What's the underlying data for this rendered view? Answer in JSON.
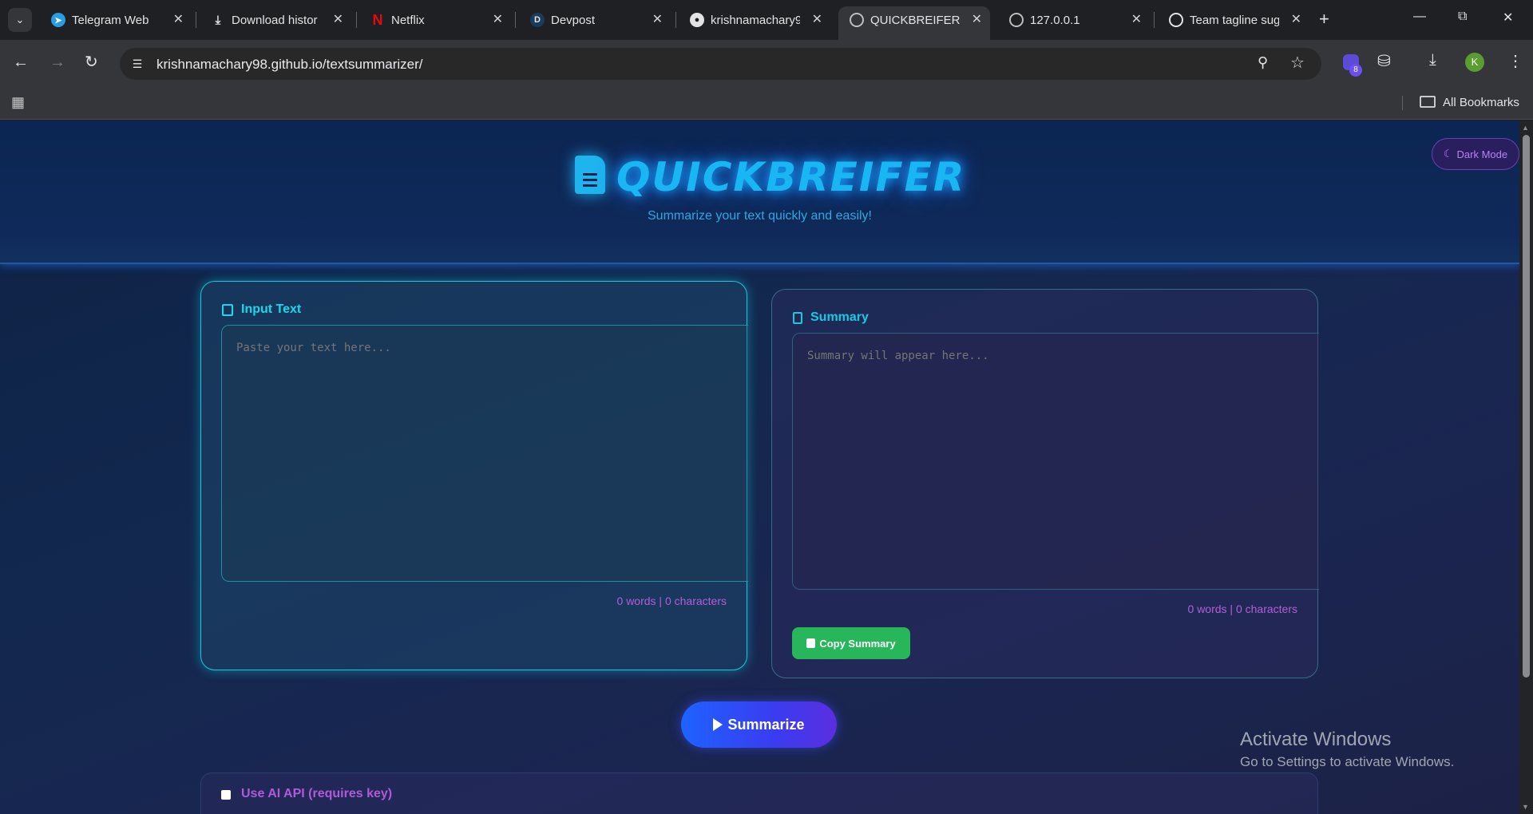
{
  "browser": {
    "tabs": [
      {
        "title": "Telegram Web",
        "icon": "telegram-icon",
        "color": "#2a9de0"
      },
      {
        "title": "Download histor",
        "icon": "download-icon",
        "color": "#e3e3e3"
      },
      {
        "title": "Netflix",
        "icon": "netflix-icon",
        "color": "#e50914"
      },
      {
        "title": "Devpost",
        "icon": "devpost-icon",
        "color": "#1c3b5a"
      },
      {
        "title": "krishnamachary9",
        "icon": "github-icon",
        "color": "#e3e3e3"
      },
      {
        "title": "QUICKBREIFER -",
        "icon": "globe-icon",
        "color": "#e3e3e3",
        "active": true
      },
      {
        "title": "127.0.0.1",
        "icon": "globe-icon",
        "color": "#e3e3e3"
      },
      {
        "title": "Team tagline sug",
        "icon": "openai-icon",
        "color": "#e3e3e3"
      }
    ],
    "url": "krishnamachary98.github.io/textsummarizer/",
    "extension_badge": "8",
    "avatar_initial": "K",
    "bookmarks_label": "All Bookmarks"
  },
  "page": {
    "title": "QUICKBREIFER",
    "subtitle": "Summarize your text quickly and easily!",
    "dark_mode_label": "Dark Mode",
    "input": {
      "heading": "Input Text",
      "placeholder": "Paste your text here...",
      "counter": "0 words | 0 characters"
    },
    "summary": {
      "heading": "Summary",
      "placeholder": "Summary will appear here...",
      "counter": "0 words | 0 characters",
      "copy_label": "Copy Summary"
    },
    "summarize_label": "Summarize",
    "api_label": "Use AI API (requires key)"
  },
  "watermark": {
    "line1": "Activate Windows",
    "line2": "Go to Settings to activate Windows."
  },
  "colors": {
    "accent_cyan": "#16d9ec",
    "title_blue": "#18b6f2",
    "counter_purple": "#b060d8",
    "copy_green": "#27b65a",
    "summarize_blue": "#1e62ff"
  }
}
